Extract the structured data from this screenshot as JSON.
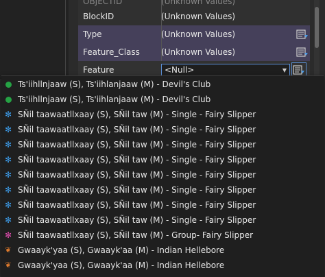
{
  "grid": {
    "rows": [
      {
        "name": "OBJECTID",
        "value": "(Unknown Values)"
      },
      {
        "name": "BlockID",
        "value": "(Unknown Values)"
      },
      {
        "name": "Type",
        "value": "(Unknown Values)"
      },
      {
        "name": "Feature_Class",
        "value": "(Unknown Values)"
      },
      {
        "name": "Feature",
        "value": "<Null>"
      }
    ]
  },
  "dropdown": {
    "items": [
      {
        "label": "Ts'iihllnjaaw (S), Ts'iihlanjaaw (M) - Devil's Club",
        "icon": "green-dot-icon"
      },
      {
        "label": "Ts'iihllnjaaw (S), Ts'iihlanjaaw (M) - Devil's Club",
        "icon": "green-dot-icon"
      },
      {
        "label": "SÑil taawaatllxaay (S), SÑil taw (M) - Single - Fairy Slipper",
        "icon": "blue-flower-icon"
      },
      {
        "label": "SÑil taawaatllxaay (S), SÑil taw (M) - Single - Fairy Slipper",
        "icon": "blue-flower-icon"
      },
      {
        "label": "SÑil taawaatllxaay (S), SÑil taw (M) - Single - Fairy Slipper",
        "icon": "blue-flower-icon"
      },
      {
        "label": "SÑil taawaatllxaay (S), SÑil taw (M) - Single - Fairy Slipper",
        "icon": "blue-flower-icon"
      },
      {
        "label": "SÑil taawaatllxaay (S), SÑil taw (M) - Single - Fairy Slipper",
        "icon": "blue-flower-icon"
      },
      {
        "label": "SÑil taawaatllxaay (S), SÑil taw (M) - Single - Fairy Slipper",
        "icon": "blue-flower-icon"
      },
      {
        "label": "SÑil taawaatllxaay (S), SÑil taw (M) - Single - Fairy Slipper",
        "icon": "blue-flower-icon"
      },
      {
        "label": "SÑil taawaatllxaay (S), SÑil taw (M) - Single - Fairy Slipper",
        "icon": "blue-flower-icon"
      },
      {
        "label": "SÑil taawaatllxaay (S), SÑil taw (M) - Group- Fairy Slipper",
        "icon": "pink-flower-icon"
      },
      {
        "label": "Gwaayk'yaa (S), Gwaayk'aa (M) - Indian Hellebore",
        "icon": "orange-leaf-icon"
      },
      {
        "label": "Gwaayk'yaa (S), Gwaayk'aa (M) - Indian Hellebore",
        "icon": "orange-leaf-icon"
      }
    ]
  },
  "colors": {
    "selected_row": "#45405a",
    "accent": "#5b8fd6",
    "green": "#25a244",
    "blue": "#3c9be8",
    "pink": "#e04cae",
    "orange": "#e07b2d"
  }
}
